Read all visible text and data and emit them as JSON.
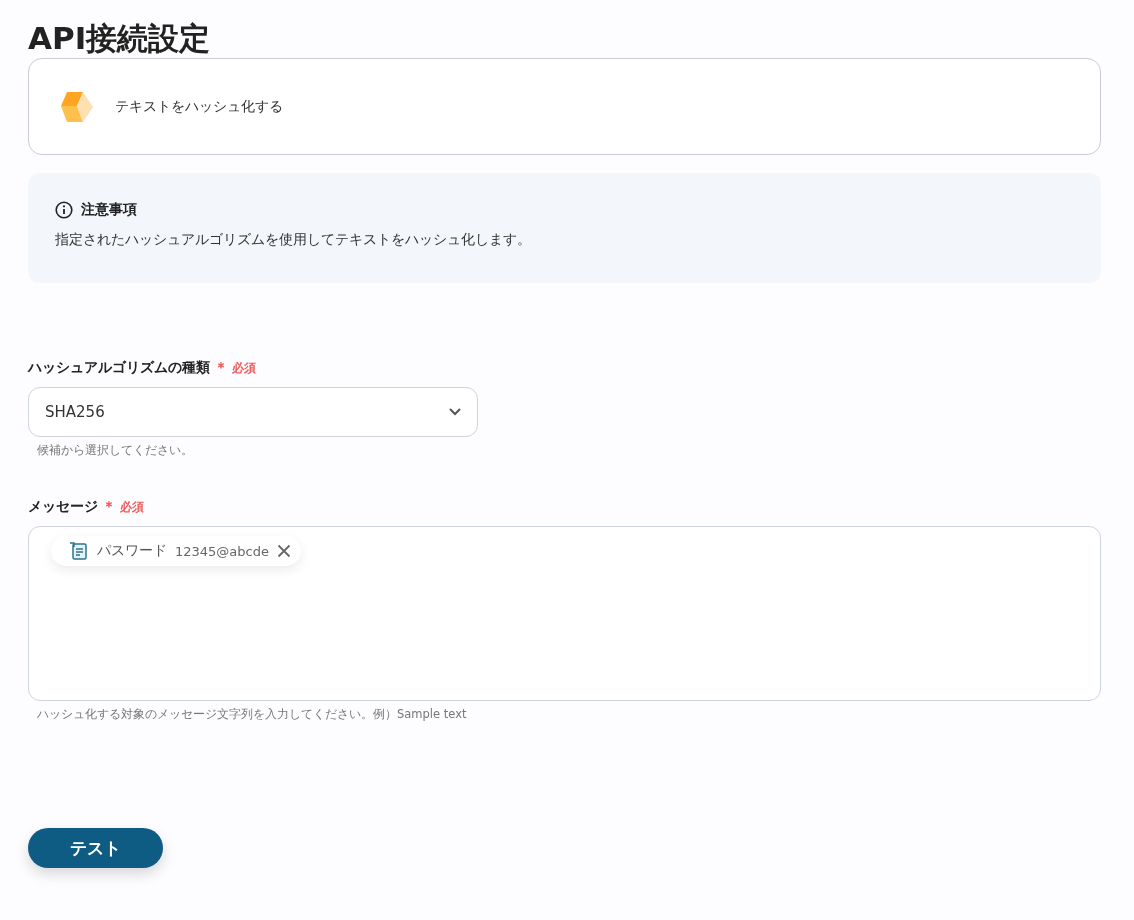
{
  "page_title": "API接続設定",
  "action_card": {
    "label": "テキストをハッシュ化する"
  },
  "notice": {
    "title": "注意事項",
    "body": "指定されたハッシュアルゴリズムを使用してテキストをハッシュ化します。"
  },
  "fields": [
    {
      "kind": "select",
      "label": "ハッシュアルゴリズムの種類",
      "required_mark": "＊",
      "required_text": "必須",
      "value": "SHA256",
      "hint": "候補から選択してください。"
    },
    {
      "kind": "textarea",
      "label": "メッセージ",
      "required_mark": "＊",
      "required_text": "必須",
      "chips": [
        {
          "name": "パスワード",
          "value": "12345@abcde"
        }
      ],
      "hint": "ハッシュ化する対象のメッセージ文字列を入力してください。例）Sample text"
    }
  ],
  "test_button": "テスト"
}
